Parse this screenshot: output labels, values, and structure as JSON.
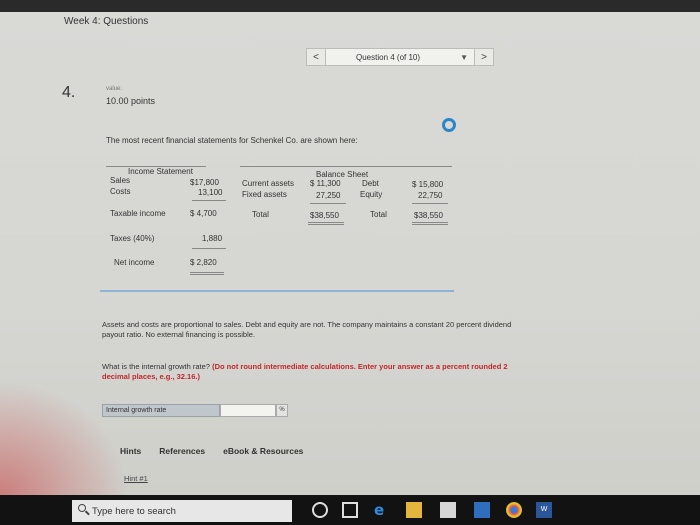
{
  "header": {
    "title": "Week 4: Questions"
  },
  "nav": {
    "prev": "<",
    "current": "Question 4 (of 10)",
    "next": ">"
  },
  "question": {
    "number": "4.",
    "value_label": "value:",
    "points": "10.00 points",
    "intro": "The most recent financial statements for Schenkel Co. are shown here:",
    "paragraph": "Assets and costs are proportional to sales. Debt and equity are not. The company maintains a constant 20 percent dividend payout ratio. No external financing is possible.",
    "prompt": "What is the internal growth rate?",
    "instruction": "(Do not round intermediate calculations. Enter your answer as a percent rounded 2 decimal places, e.g., 32.16.)"
  },
  "income_statement": {
    "title": "Income Statement",
    "rows": [
      {
        "label": "Sales",
        "value": "$17,800"
      },
      {
        "label": "Costs",
        "value": "13,100"
      },
      {
        "label": "Taxable income",
        "value": "$ 4,700"
      },
      {
        "label": "Taxes (40%)",
        "value": "1,880"
      },
      {
        "label": "Net income",
        "value": "$ 2,820"
      }
    ]
  },
  "balance_sheet": {
    "title": "Balance Sheet",
    "assets": [
      {
        "label": "Current assets",
        "value": "$ 11,300"
      },
      {
        "label": "Fixed assets",
        "value": "27,250"
      },
      {
        "label": "Total",
        "value": "$38,550"
      }
    ],
    "liabilities": [
      {
        "label": "Debt",
        "value": "$ 15,800"
      },
      {
        "label": "Equity",
        "value": "22,750"
      },
      {
        "label": "Total",
        "value": "$38,550"
      }
    ]
  },
  "answer": {
    "label": "Internal growth rate",
    "value": "",
    "unit": "%"
  },
  "tabs": [
    "Hints",
    "References",
    "eBook & Resources"
  ],
  "hint_link": "Hint #1",
  "taskbar": {
    "search_placeholder": "Type here to search"
  }
}
